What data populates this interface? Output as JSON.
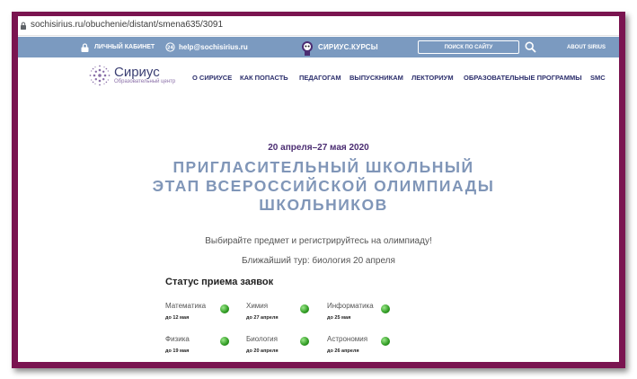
{
  "browser": {
    "url": "sochisirius.ru/obuchenie/distant/smena635/3091"
  },
  "topbar": {
    "cabinet": "ЛИЧНЫЙ КАБИНЕТ",
    "email": "help@sochisirius.ru",
    "logo_text": "СИРИУС.КУРСЫ",
    "search_placeholder": "ПОИСК ПО САЙТУ",
    "about": "ABOUT SIRIUS"
  },
  "brand": {
    "name": "Сириус",
    "subtitle": "Образовательный центр"
  },
  "nav": {
    "items": [
      "О СИРИУСЕ",
      "КАК ПОПАСТЬ",
      "ПЕДАГОГАМ",
      "ВЫПУСКНИКАМ",
      "ЛЕКТОРИУМ",
      "ОБРАЗОВАТЕЛЬНЫЕ ПРОГРАММЫ",
      "SMC"
    ]
  },
  "hero": {
    "dates": "20 апреля–27 мая 2020",
    "title_lines": [
      "ПРИГЛАСИТЕЛЬНЫЙ ШКОЛЬНЫЙ",
      "ЭТАП ВСЕРОССИЙСКОЙ ОЛИМПИАДЫ",
      "ШКОЛЬНИКОВ"
    ],
    "subtitle": "Выбирайте предмет и регистрируйтесь на олимпиаду!",
    "next_round": "Ближайший тур: биология 20 апреля"
  },
  "status": {
    "title": "Статус приема заявок",
    "subjects": [
      {
        "name": "Математика",
        "deadline": "до 12 мая"
      },
      {
        "name": "Химия",
        "deadline": "до 27 апреля"
      },
      {
        "name": "Информатика",
        "deadline": "до 25 мая"
      },
      {
        "name": "Физика",
        "deadline": "до 19 мая"
      },
      {
        "name": "Биология",
        "deadline": "до 20 апреля"
      },
      {
        "name": "Астрономия",
        "deadline": "до 26 апреля"
      }
    ],
    "status_color": "#2f9a22"
  },
  "colors": {
    "frame": "#7a1450",
    "topbar": "#7b9ac0",
    "title": "#8096b8",
    "nav": "#2c2f6c"
  }
}
